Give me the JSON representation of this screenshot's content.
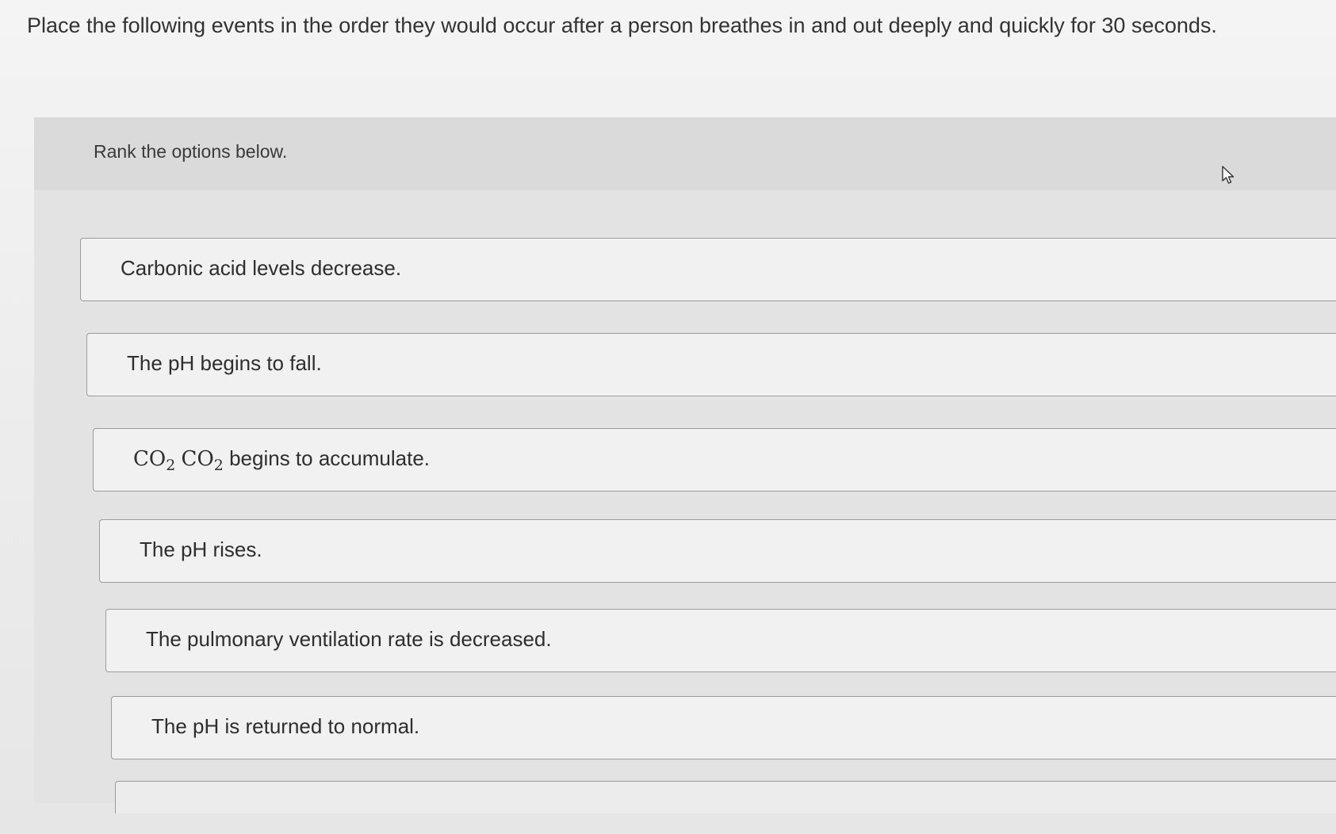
{
  "question": {
    "text": "Place the following events in the order they would occur after a person breathes in and out deeply and quickly for 30 seconds."
  },
  "ranking": {
    "instruction": "Rank the options below.",
    "options": [
      {
        "label": "Carbonic acid levels decrease."
      },
      {
        "label": "The pH begins to fall."
      },
      {
        "formula_a": "CO",
        "sub_a": "2",
        "formula_b": "CO",
        "sub_b": "2",
        "suffix": "begins to accumulate."
      },
      {
        "label": "The pH rises."
      },
      {
        "label": "The pulmonary ventilation rate is decreased."
      },
      {
        "label": "The pH is returned to normal."
      }
    ]
  },
  "icons": {
    "cursor": "mouse-pointer-icon"
  }
}
